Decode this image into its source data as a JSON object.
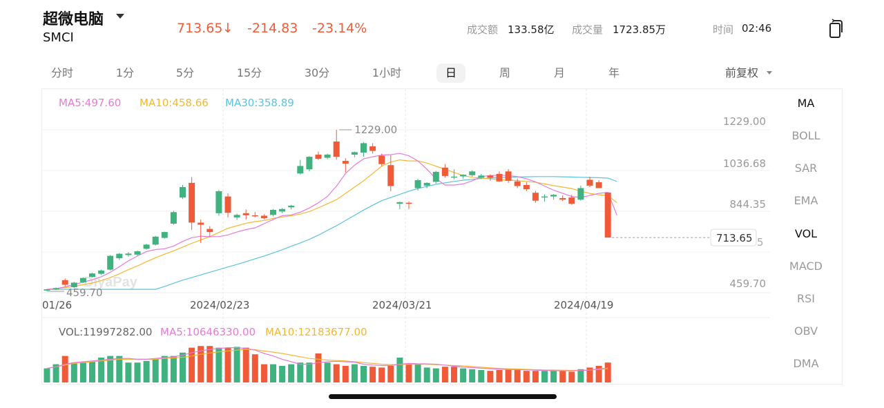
{
  "header": {
    "name": "超微电脑",
    "code": "SMCI",
    "price": "713.65",
    "arrow": "↓",
    "change": "-214.83",
    "change_pct": "-23.14%",
    "turnover_label": "成交额",
    "turnover_value": "133.58亿",
    "volume_label": "成交量",
    "volume_value": "1723.85万",
    "time_label": "时间",
    "time_value": "02:46"
  },
  "periods": [
    "分时",
    "1分",
    "5分",
    "15分",
    "30分",
    "1小时",
    "日",
    "周",
    "月",
    "年"
  ],
  "active_period": "日",
  "adjust_label": "前复权",
  "indicators": [
    "MA",
    "BOLL",
    "SAR",
    "EMA",
    "VOL",
    "MACD",
    "RSI",
    "OBV",
    "DMA"
  ],
  "active_indicators": [
    "MA",
    "VOL"
  ],
  "ma_legend": {
    "ma5": "MA5:497.60",
    "ma10": "MA10:458.66",
    "ma30": "MA30:358.89"
  },
  "vol_legend": {
    "vol": "VOL:11997282.00",
    "ma5": "MA5:10646330.00",
    "ma10": "MA10:12183677.00"
  },
  "price_axis_labels": [
    "1229.00",
    "1036.68",
    "844.35",
    "459.70"
  ],
  "date_labels": [
    "01/26",
    "2024/02/23",
    "2024/03/21",
    "2024/04/19"
  ],
  "high_marker": "1229.00",
  "low_marker": "459.70",
  "last_price_tag": "713.65",
  "watermark": "DiyaPay",
  "colors": {
    "up": "#3fb27f",
    "down": "#ef5b38",
    "ma5": "#e77ad8",
    "ma10": "#f4b731",
    "ma30": "#5bc2df",
    "accent_text": "#ef5b38"
  },
  "chart_data": {
    "type": "candlestick",
    "y_range": [
      459.7,
      1229.0
    ],
    "candles": [
      {
        "o": 460,
        "h": 468,
        "l": 455,
        "c": 466
      },
      {
        "o": 466,
        "h": 475,
        "l": 462,
        "c": 472
      },
      {
        "o": 510,
        "h": 518,
        "l": 480,
        "c": 488
      },
      {
        "o": 476,
        "h": 502,
        "l": 473,
        "c": 498
      },
      {
        "o": 500,
        "h": 523,
        "l": 496,
        "c": 520
      },
      {
        "o": 525,
        "h": 545,
        "l": 522,
        "c": 542
      },
      {
        "o": 540,
        "h": 560,
        "l": 534,
        "c": 556
      },
      {
        "o": 560,
        "h": 630,
        "l": 556,
        "c": 626
      },
      {
        "o": 615,
        "h": 640,
        "l": 606,
        "c": 636
      },
      {
        "o": 630,
        "h": 644,
        "l": 622,
        "c": 637
      },
      {
        "o": 632,
        "h": 652,
        "l": 626,
        "c": 648
      },
      {
        "o": 660,
        "h": 684,
        "l": 656,
        "c": 680
      },
      {
        "o": 680,
        "h": 722,
        "l": 676,
        "c": 718
      },
      {
        "o": 712,
        "h": 742,
        "l": 708,
        "c": 740
      },
      {
        "o": 780,
        "h": 842,
        "l": 775,
        "c": 835
      },
      {
        "o": 905,
        "h": 965,
        "l": 898,
        "c": 955
      },
      {
        "o": 975,
        "h": 1003,
        "l": 750,
        "c": 785
      },
      {
        "o": 785,
        "h": 800,
        "l": 687,
        "c": 775
      },
      {
        "o": 755,
        "h": 768,
        "l": 715,
        "c": 740
      },
      {
        "o": 830,
        "h": 942,
        "l": 818,
        "c": 935
      },
      {
        "o": 910,
        "h": 925,
        "l": 810,
        "c": 832
      },
      {
        "o": 810,
        "h": 828,
        "l": 798,
        "c": 822
      },
      {
        "o": 830,
        "h": 848,
        "l": 800,
        "c": 820
      },
      {
        "o": 820,
        "h": 836,
        "l": 810,
        "c": 817
      },
      {
        "o": 818,
        "h": 825,
        "l": 801,
        "c": 806
      },
      {
        "o": 822,
        "h": 850,
        "l": 815,
        "c": 846
      },
      {
        "o": 838,
        "h": 855,
        "l": 830,
        "c": 850
      },
      {
        "o": 858,
        "h": 870,
        "l": 848,
        "c": 866
      },
      {
        "o": 1020,
        "h": 1085,
        "l": 1015,
        "c": 1056
      },
      {
        "o": 1040,
        "h": 1103,
        "l": 1030,
        "c": 1100
      },
      {
        "o": 1110,
        "h": 1125,
        "l": 1085,
        "c": 1090
      },
      {
        "o": 1095,
        "h": 1115,
        "l": 1088,
        "c": 1110
      },
      {
        "o": 1173,
        "h": 1229,
        "l": 1086,
        "c": 1100
      },
      {
        "o": 1080,
        "h": 1093,
        "l": 1025,
        "c": 1067
      },
      {
        "o": 1110,
        "h": 1125,
        "l": 1098,
        "c": 1122
      },
      {
        "o": 1120,
        "h": 1170,
        "l": 1100,
        "c": 1165
      },
      {
        "o": 1150,
        "h": 1165,
        "l": 1115,
        "c": 1128
      },
      {
        "o": 1105,
        "h": 1115,
        "l": 1055,
        "c": 1065
      },
      {
        "o": 1060,
        "h": 1107,
        "l": 935,
        "c": 960
      },
      {
        "o": 875,
        "h": 885,
        "l": 850,
        "c": 883
      },
      {
        "o": 880,
        "h": 887,
        "l": 850,
        "c": 878
      },
      {
        "o": 950,
        "h": 995,
        "l": 938,
        "c": 988
      },
      {
        "o": 962,
        "h": 978,
        "l": 950,
        "c": 975
      },
      {
        "o": 980,
        "h": 1032,
        "l": 972,
        "c": 1028
      },
      {
        "o": 1048,
        "h": 1065,
        "l": 1000,
        "c": 1008
      },
      {
        "o": 1000,
        "h": 1040,
        "l": 992,
        "c": 1005
      },
      {
        "o": 1006,
        "h": 1016,
        "l": 996,
        "c": 1014
      },
      {
        "o": 1012,
        "h": 1035,
        "l": 1005,
        "c": 1030
      },
      {
        "o": 1000,
        "h": 1018,
        "l": 994,
        "c": 1010
      },
      {
        "o": 1010,
        "h": 1016,
        "l": 985,
        "c": 1000
      },
      {
        "o": 1018,
        "h": 1030,
        "l": 980,
        "c": 982
      },
      {
        "o": 1030,
        "h": 1041,
        "l": 975,
        "c": 985
      },
      {
        "o": 982,
        "h": 996,
        "l": 950,
        "c": 960
      },
      {
        "o": 965,
        "h": 978,
        "l": 935,
        "c": 945
      },
      {
        "o": 928,
        "h": 937,
        "l": 880,
        "c": 890
      },
      {
        "o": 905,
        "h": 920,
        "l": 885,
        "c": 910
      },
      {
        "o": 910,
        "h": 922,
        "l": 895,
        "c": 918
      },
      {
        "o": 902,
        "h": 915,
        "l": 888,
        "c": 895
      },
      {
        "o": 905,
        "h": 918,
        "l": 870,
        "c": 875
      },
      {
        "o": 895,
        "h": 962,
        "l": 890,
        "c": 950
      },
      {
        "o": 990,
        "h": 1005,
        "l": 955,
        "c": 962
      },
      {
        "o": 978,
        "h": 988,
        "l": 950,
        "c": 950
      },
      {
        "o": 928.48,
        "h": 928.48,
        "l": 713.65,
        "c": 713.65
      }
    ],
    "ma5": [
      466,
      469,
      478,
      489,
      500,
      512,
      526,
      548,
      574,
      602,
      625,
      647,
      656,
      660,
      673,
      695,
      713,
      720,
      718,
      718,
      726,
      740,
      752,
      760,
      780,
      800,
      818,
      822,
      835,
      855,
      880,
      910,
      960,
      1020,
      1060,
      1090,
      1100,
      1108,
      1110,
      1116,
      1105,
      1080,
      1040,
      995,
      965,
      965,
      970,
      985,
      1005,
      1010,
      1012,
      1010,
      1005,
      995,
      980,
      960,
      940,
      925,
      910,
      905,
      915,
      925,
      930,
      820
    ],
    "ma10": [
      466,
      469,
      474,
      480,
      488,
      496,
      508,
      522,
      540,
      560,
      578,
      598,
      617,
      634,
      650,
      668,
      686,
      702,
      718,
      738,
      758,
      770,
      782,
      790,
      795,
      805,
      812,
      818,
      826,
      838,
      856,
      875,
      895,
      925,
      955,
      985,
      1020,
      1055,
      1075,
      1085,
      1080,
      1080,
      1070,
      1055,
      1040,
      1025,
      1010,
      1002,
      998,
      994,
      990,
      988,
      986,
      982,
      978,
      970,
      962,
      955,
      948,
      935,
      925,
      918,
      915,
      880
    ],
    "ma30": [
      466,
      466,
      466,
      466,
      466,
      466,
      466,
      466,
      466,
      466,
      466,
      466,
      466,
      480,
      495,
      510,
      522,
      535,
      548,
      560,
      573,
      585,
      598,
      612,
      625,
      640,
      655,
      672,
      688,
      705,
      725,
      748,
      770,
      795,
      820,
      845,
      868,
      890,
      905,
      920,
      935,
      948,
      958,
      968,
      975,
      982,
      988,
      992,
      996,
      998,
      1000,
      1002,
      1003,
      1004,
      1005,
      1005,
      1005,
      1004,
      1003,
      1002,
      1001,
      1000,
      998,
      982
    ],
    "volume": {
      "values": [
        8.5,
        11,
        16,
        12,
        12.3,
        12.6,
        15,
        16,
        16,
        12,
        12,
        13,
        14,
        16,
        16,
        18,
        21,
        22,
        22,
        21,
        21,
        21.5,
        21,
        17,
        11,
        11,
        10,
        11,
        12,
        12,
        17.5,
        12,
        11,
        10,
        11,
        10,
        9.5,
        9,
        10,
        15,
        11,
        11,
        9,
        8.5,
        9.5,
        9.5,
        8.5,
        8,
        7.5,
        7,
        7.5,
        8,
        8,
        7,
        7,
        7,
        7.5,
        7,
        6.5,
        8,
        9,
        10,
        12
      ],
      "up": [
        true,
        true,
        false,
        true,
        true,
        true,
        true,
        true,
        true,
        true,
        true,
        true,
        true,
        true,
        true,
        true,
        false,
        false,
        false,
        true,
        false,
        true,
        false,
        false,
        false,
        true,
        true,
        true,
        true,
        true,
        false,
        true,
        false,
        false,
        true,
        true,
        false,
        false,
        false,
        true,
        false,
        true,
        true,
        true,
        false,
        false,
        true,
        true,
        true,
        false,
        false,
        false,
        false,
        false,
        false,
        true,
        true,
        false,
        false,
        true,
        false,
        false,
        false
      ],
      "ma5": [
        8.5,
        9.5,
        11,
        12,
        12.5,
        13,
        13.5,
        14,
        14.5,
        14.5,
        14,
        14,
        14.5,
        15,
        15.5,
        16.5,
        18,
        19,
        20,
        20.5,
        21,
        21,
        20.5,
        19.5,
        17.5,
        16,
        14,
        12.5,
        11,
        11,
        12,
        12.5,
        12.8,
        12.5,
        12.3,
        11,
        10.5,
        10.2,
        10.2,
        11,
        11.5,
        11.3,
        11.2,
        11,
        10.5,
        9.8,
        9.2,
        9,
        8.6,
        8.3,
        8,
        7.8,
        7.7,
        7.6,
        7.4,
        7.2,
        7.1,
        7,
        7,
        7.2,
        7.5,
        8.2,
        8.7
      ],
      "ma10": [
        8.5,
        9.5,
        10.5,
        11.5,
        12,
        12.5,
        13,
        13.5,
        14,
        14,
        14,
        14,
        14,
        14.5,
        14.8,
        15.2,
        16,
        17,
        17.8,
        18.5,
        19,
        19.5,
        20,
        19.8,
        19,
        18.3,
        17.5,
        16.5,
        15.5,
        14.5,
        14,
        13.5,
        13.2,
        13,
        12.5,
        12,
        11.5,
        11,
        10.8,
        10.8,
        11,
        11,
        11,
        10.8,
        10.5,
        10.2,
        10,
        9.6,
        9.2,
        8.8,
        8.5,
        8.3,
        8.1,
        7.9,
        7.7,
        7.6,
        7.5,
        7.4,
        7.3,
        7.3,
        7.5,
        7.9,
        8.3
      ],
      "max": 25
    }
  }
}
